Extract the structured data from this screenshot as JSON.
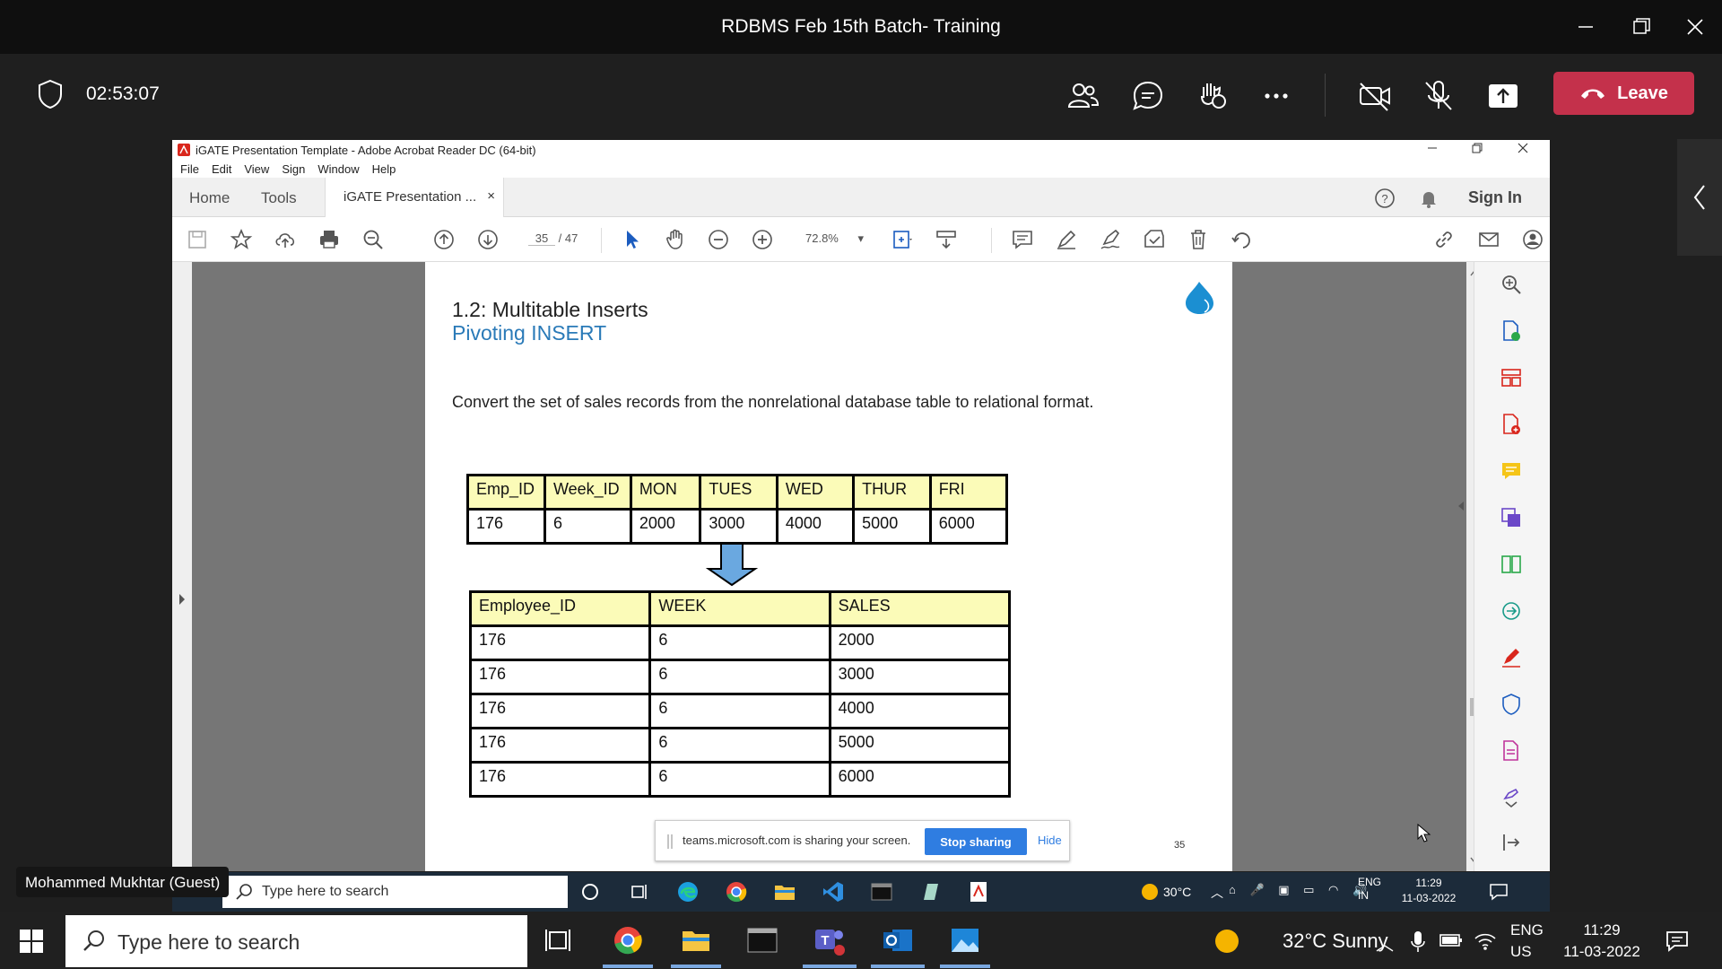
{
  "window": {
    "title": "RDBMS Feb 15th Batch- Training"
  },
  "meeting": {
    "timer": "02:53:07",
    "leave_label": "Leave"
  },
  "acrobat": {
    "title": "iGATE Presentation Template - Adobe Acrobat Reader DC (64-bit)",
    "menu": [
      "File",
      "Edit",
      "View",
      "Sign",
      "Window",
      "Help"
    ],
    "tabs": {
      "home": "Home",
      "tools": "Tools",
      "doc": "iGATE Presentation ...",
      "close": "×"
    },
    "sign_in": "Sign In",
    "page_current": "35",
    "page_total": "/ 47",
    "zoom": "72.8%"
  },
  "slide": {
    "heading": "1.2: Multitable Inserts",
    "subheading": "Pivoting INSERT",
    "body": "Convert the set of sales records from the nonrelational database table to relational format.",
    "source_table": {
      "headers": [
        "Emp_ID",
        "Week_ID",
        "MON",
        "TUES",
        "WED",
        "THUR",
        "FRI"
      ],
      "rows": [
        [
          "176",
          "6",
          "2000",
          "3000",
          "4000",
          "5000",
          "6000"
        ]
      ]
    },
    "target_table": {
      "headers": [
        "Employee_ID",
        "WEEK",
        "SALES"
      ],
      "rows": [
        [
          "176",
          "6",
          "2000"
        ],
        [
          "176",
          "6",
          "3000"
        ],
        [
          "176",
          "6",
          "4000"
        ],
        [
          "176",
          "6",
          "5000"
        ],
        [
          "176",
          "6",
          "6000"
        ]
      ]
    },
    "slide_number": "35"
  },
  "share_bar": {
    "text": "teams.microsoft.com is sharing your screen.",
    "stop": "Stop sharing",
    "hide": "Hide"
  },
  "remote_taskbar": {
    "search": "Type here to search",
    "temp": "30°C",
    "lang1": "ENG",
    "lang2": "IN",
    "time": "11:29",
    "date": "11-03-2022"
  },
  "participant": {
    "name": "Mohammed Mukhtar (Guest)"
  },
  "taskbar": {
    "search": "Type here to search",
    "weather": "32°C  Sunny",
    "lang1": "ENG",
    "lang2": "US",
    "time": "11:29",
    "date": "11-03-2022"
  },
  "colors": {
    "leave": "#c4314b",
    "accent": "#2f7de1",
    "header_fill": "#fbfbb8",
    "subheading": "#2a7ab8"
  }
}
